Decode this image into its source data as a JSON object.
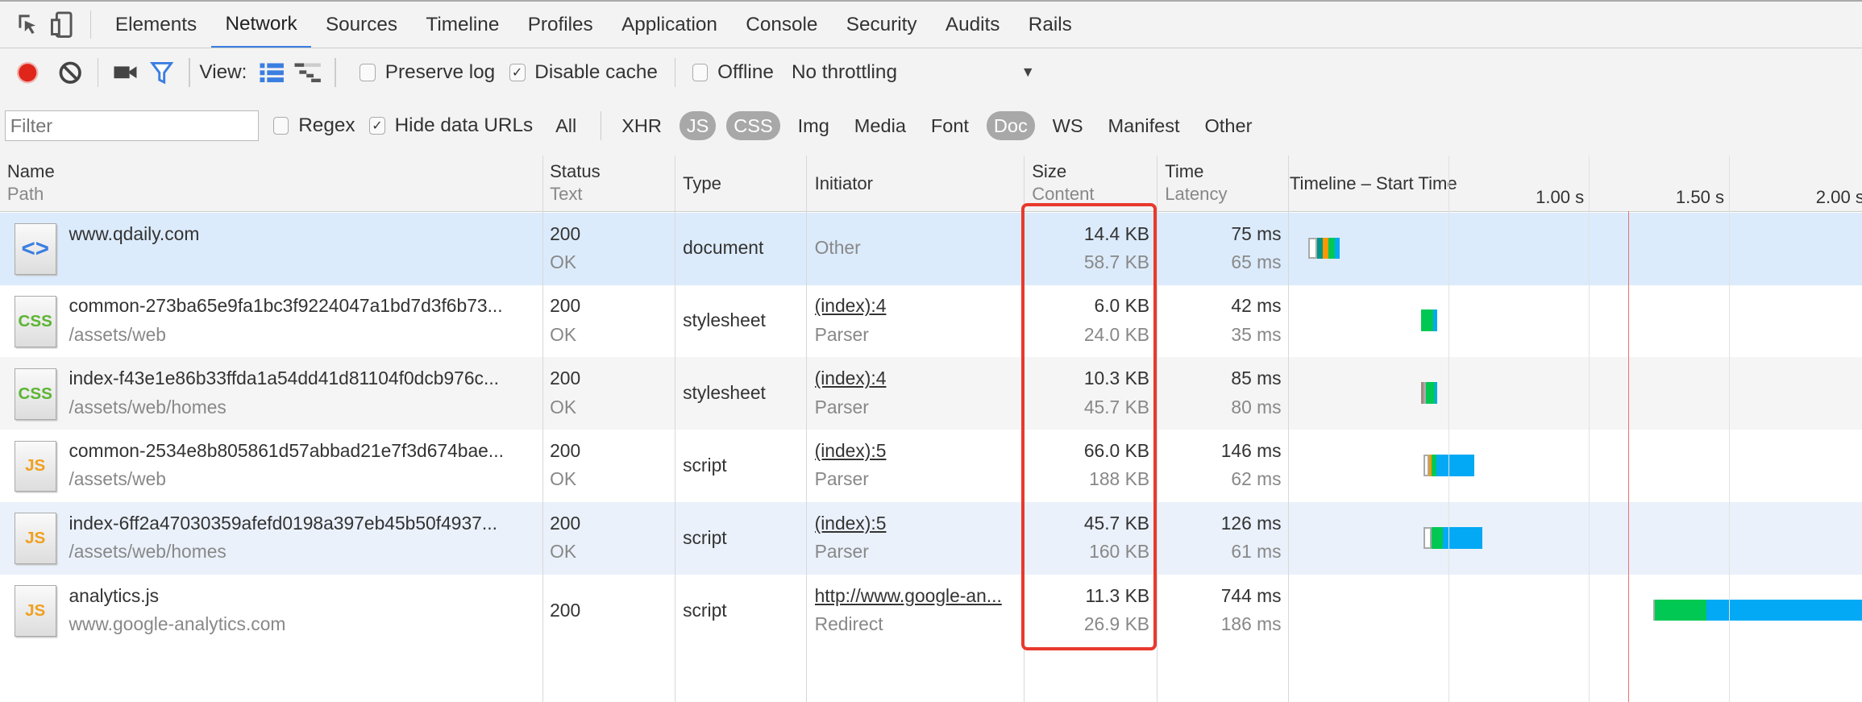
{
  "tabs": [
    "Elements",
    "Network",
    "Sources",
    "Timeline",
    "Profiles",
    "Application",
    "Console",
    "Security",
    "Audits",
    "Rails"
  ],
  "active_tab": "Network",
  "toolbar": {
    "view_label": "View:",
    "preserve_log": {
      "label": "Preserve log",
      "checked": false
    },
    "disable_cache": {
      "label": "Disable cache",
      "checked": true
    },
    "offline": {
      "label": "Offline",
      "checked": false
    },
    "throttling": "No throttling"
  },
  "filterbar": {
    "placeholder": "Filter",
    "regex": {
      "label": "Regex",
      "checked": false
    },
    "hide_data_urls": {
      "label": "Hide data URLs",
      "checked": true
    },
    "types": [
      {
        "label": "All",
        "on": false
      },
      {
        "label": "XHR",
        "on": false
      },
      {
        "label": "JS",
        "on": true
      },
      {
        "label": "CSS",
        "on": true
      },
      {
        "label": "Img",
        "on": false
      },
      {
        "label": "Media",
        "on": false
      },
      {
        "label": "Font",
        "on": false
      },
      {
        "label": "Doc",
        "on": true
      },
      {
        "label": "WS",
        "on": false
      },
      {
        "label": "Manifest",
        "on": false
      },
      {
        "label": "Other",
        "on": false
      }
    ]
  },
  "columns": {
    "name": "Name",
    "path": "Path",
    "status": "Status",
    "text": "Text",
    "type": "Type",
    "initiator": "Initiator",
    "size": "Size",
    "content": "Content",
    "time": "Time",
    "latency": "Latency",
    "timeline": "Timeline – Start Time"
  },
  "timeline": {
    "ticks": [
      {
        "t": 1.0,
        "label": "1.00 s"
      },
      {
        "t": 1.5,
        "label": "1.50 s"
      },
      {
        "t": 2.0,
        "label": "2.00 s"
      }
    ],
    "load_event_s": 1.14,
    "colors": {
      "queue": "#ffffff",
      "stalled": "#aaaaaa",
      "proxy": "#a1887f",
      "dns": "#009688",
      "connect": "#ff9800",
      "waiting": "#00c853",
      "download": "#03a9f4",
      "load_line": "#e57373"
    }
  },
  "requests": [
    {
      "name": "www.qdaily.com",
      "path": "",
      "icon": "document-icon",
      "status": "200",
      "text": "OK",
      "type": "document",
      "initiator": "Other",
      "initiator_link": false,
      "initiator_sub": "",
      "size": "14.4 KB",
      "content": "58.7 KB",
      "time": "75 ms",
      "latency": "65 ms",
      "state": "selected",
      "segments": [
        [
          0.0,
          0.03,
          "queue"
        ],
        [
          0.03,
          0.05,
          "dns"
        ],
        [
          0.05,
          0.07,
          "connect"
        ],
        [
          0.07,
          0.095,
          "waiting"
        ],
        [
          0.095,
          0.11,
          "download"
        ]
      ]
    },
    {
      "name": "common-273ba65e9fa1bc3f9224047a1bd7d3f6b73...",
      "path": "/assets/web",
      "icon": "css-file-icon",
      "status": "200",
      "text": "OK",
      "type": "stylesheet",
      "initiator": "(index):4",
      "initiator_link": true,
      "initiator_sub": "Parser",
      "size": "6.0 KB",
      "content": "24.0 KB",
      "time": "42 ms",
      "latency": "35 ms",
      "state": "",
      "segments": [
        [
          0.4,
          0.445,
          "waiting"
        ],
        [
          0.445,
          0.46,
          "download"
        ]
      ]
    },
    {
      "name": "index-f43e1e86b33ffda1a54dd41d81104f0dcb976c...",
      "path": "/assets/web/homes",
      "icon": "css-file-icon",
      "status": "200",
      "text": "OK",
      "type": "stylesheet",
      "initiator": "(index):4",
      "initiator_link": true,
      "initiator_sub": "Parser",
      "size": "10.3 KB",
      "content": "45.7 KB",
      "time": "85 ms",
      "latency": "80 ms",
      "state": "alt",
      "segments": [
        [
          0.4,
          0.41,
          "proxy"
        ],
        [
          0.41,
          0.42,
          "stalled"
        ],
        [
          0.42,
          0.45,
          "waiting"
        ],
        [
          0.45,
          0.46,
          "download"
        ]
      ]
    },
    {
      "name": "common-2534e8b805861d57abbad21e7f3d674bae...",
      "path": "/assets/web",
      "icon": "js-file-icon",
      "status": "200",
      "text": "OK",
      "type": "script",
      "initiator": "(index):5",
      "initiator_link": true,
      "initiator_sub": "Parser",
      "size": "66.0 KB",
      "content": "188 KB",
      "time": "146 ms",
      "latency": "62 ms",
      "state": "",
      "segments": [
        [
          0.41,
          0.43,
          "queue"
        ],
        [
          0.43,
          0.44,
          "connect"
        ],
        [
          0.44,
          0.455,
          "waiting"
        ],
        [
          0.455,
          0.59,
          "download"
        ]
      ]
    },
    {
      "name": "index-6ff2a47030359afefd0198a397eb45b50f4937...",
      "path": "/assets/web/homes",
      "icon": "js-file-icon",
      "status": "200",
      "text": "OK",
      "type": "script",
      "initiator": "(index):5",
      "initiator_link": true,
      "initiator_sub": "Parser",
      "size": "45.7 KB",
      "content": "160 KB",
      "time": "126 ms",
      "latency": "61 ms",
      "state": "hover",
      "segments": [
        [
          0.41,
          0.44,
          "queue"
        ],
        [
          0.44,
          0.48,
          "waiting"
        ],
        [
          0.48,
          0.62,
          "download"
        ]
      ]
    },
    {
      "name": "analytics.js",
      "path": "www.google-analytics.com",
      "icon": "js-file-icon",
      "status": "200",
      "text": "",
      "type": "script",
      "initiator": "http://www.google-an...",
      "initiator_link": true,
      "initiator_sub": "Redirect",
      "size": "11.3 KB",
      "content": "26.9 KB",
      "time": "744 ms",
      "latency": "186 ms",
      "state": "",
      "segments": [
        [
          1.23,
          1.235,
          "stalled"
        ],
        [
          1.235,
          1.42,
          "waiting"
        ],
        [
          1.42,
          2.1,
          "download"
        ]
      ]
    }
  ]
}
